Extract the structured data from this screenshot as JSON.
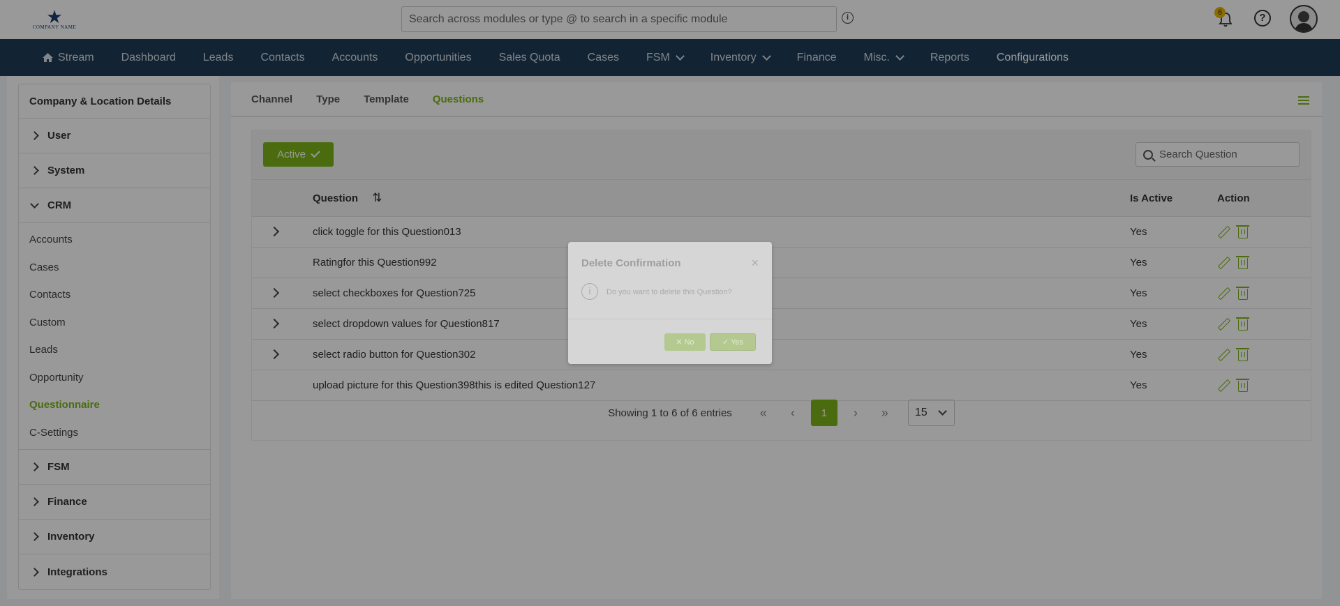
{
  "header": {
    "logo_text": "COMPANY NAME",
    "search_placeholder": "Search across modules or type @ to search in a specific module",
    "notification_count": "6",
    "help_glyph": "?",
    "info_glyph": "i"
  },
  "nav": {
    "items": [
      {
        "label": "Stream",
        "icon": "home-icon"
      },
      {
        "label": "Dashboard"
      },
      {
        "label": "Leads"
      },
      {
        "label": "Contacts"
      },
      {
        "label": "Accounts"
      },
      {
        "label": "Opportunities"
      },
      {
        "label": "Sales Quota"
      },
      {
        "label": "Cases"
      },
      {
        "label": "FSM",
        "dropdown": true
      },
      {
        "label": "Inventory",
        "dropdown": true
      },
      {
        "label": "Finance"
      },
      {
        "label": "Misc.",
        "dropdown": true
      },
      {
        "label": "Reports"
      },
      {
        "label": "Configurations",
        "current": true
      }
    ]
  },
  "sidebar": {
    "header": "Company & Location Details",
    "groups_top": [
      "User",
      "System"
    ],
    "crm_label": "CRM",
    "crm_items": [
      "Accounts",
      "Cases",
      "Contacts",
      "Custom",
      "Leads",
      "Opportunity",
      "Questionnaire",
      "C-Settings"
    ],
    "active_item": "Questionnaire",
    "groups_bottom": [
      "FSM",
      "Finance",
      "Inventory",
      "Integrations"
    ]
  },
  "tabs": [
    "Channel",
    "Type",
    "Template",
    "Questions"
  ],
  "active_tab": "Questions",
  "toolbar": {
    "active_label": "Active",
    "search_placeholder": "Search Question"
  },
  "table": {
    "headers": {
      "question": "Question",
      "is_active": "Is Active",
      "action": "Action"
    },
    "rows": [
      {
        "question": "click toggle for this Question013",
        "is_active": "Yes",
        "expandable": true
      },
      {
        "question": "Ratingfor this Question992",
        "is_active": "Yes",
        "expandable": false
      },
      {
        "question": "select checkboxes for Question725",
        "is_active": "Yes",
        "expandable": true
      },
      {
        "question": "select dropdown values for Question817",
        "is_active": "Yes",
        "expandable": true
      },
      {
        "question": "select radio button for Question302",
        "is_active": "Yes",
        "expandable": true
      },
      {
        "question": "upload picture for this Question398this is edited Question127",
        "is_active": "Yes",
        "expandable": false
      }
    ]
  },
  "pagination": {
    "info": "Showing 1 to 6 of 6 entries",
    "current_page": "1",
    "per_page": "15"
  },
  "modal": {
    "title": "Delete Confirmation",
    "message": "Do you want to delete this Question?",
    "no_label": "No",
    "yes_label": "Yes",
    "close_glyph": "×"
  },
  "colors": {
    "accent": "#7cb518",
    "navbar": "#1f3c57"
  }
}
